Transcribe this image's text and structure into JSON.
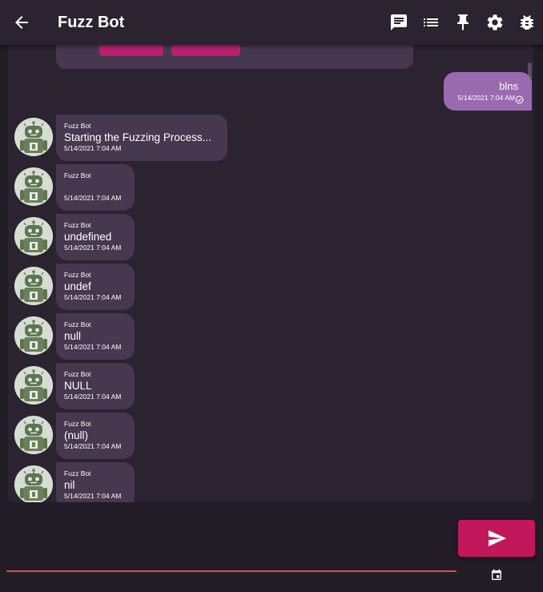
{
  "appbar": {
    "title": "Fuzz Bot",
    "actions": [
      "chat-icon",
      "list-icon",
      "pin-icon",
      "settings-icon",
      "bug-icon"
    ]
  },
  "user_message": {
    "text": "blns",
    "time": "5/14/2021 7:04 AM"
  },
  "bot_messages": [
    {
      "sender": "Fuzz Bot",
      "text": "Starting the Fuzzing Process...",
      "time": "5/14/2021 7:04 AM"
    },
    {
      "sender": "Fuzz Bot",
      "text": "",
      "time": "5/14/2021 7:04 AM"
    },
    {
      "sender": "Fuzz Bot",
      "text": "undefined",
      "time": "5/14/2021 7:04 AM"
    },
    {
      "sender": "Fuzz Bot",
      "text": "undef",
      "time": "5/14/2021 7:04 AM"
    },
    {
      "sender": "Fuzz Bot",
      "text": "null",
      "time": "5/14/2021 7:04 AM"
    },
    {
      "sender": "Fuzz Bot",
      "text": "NULL",
      "time": "5/14/2021 7:04 AM"
    },
    {
      "sender": "Fuzz Bot",
      "text": "(null)",
      "time": "5/14/2021 7:04 AM"
    },
    {
      "sender": "Fuzz Bot",
      "text": "nil",
      "time": "5/14/2021 7:04 AM"
    }
  ],
  "composer": {
    "input_value": "",
    "send_icon": "send-icon",
    "calendar_icon": "calendar-icon"
  },
  "colors": {
    "background": "#221c26",
    "surface": "#2b2330",
    "bot_bubble": "#46384f",
    "user_bubble": "#9a6ab1",
    "accent": "#c2185b",
    "input_underline": "#e0464a"
  }
}
